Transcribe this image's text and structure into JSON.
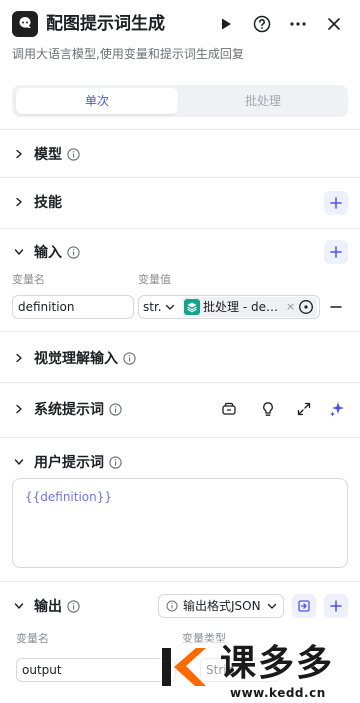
{
  "header": {
    "title": "配图提示词生成",
    "subtitle": "调用大语言模型,使用变量和提示词生成回复",
    "icons": [
      "app-logo-icon",
      "play-icon",
      "help-icon",
      "more-icon",
      "close-icon"
    ]
  },
  "tabs": [
    {
      "label": "单次",
      "active": true
    },
    {
      "label": "批处理",
      "active": false
    }
  ],
  "sections": {
    "model": {
      "label": "模型"
    },
    "skills": {
      "label": "技能"
    },
    "input": {
      "label": "输入",
      "col_name": "变量名",
      "col_value": "变量值",
      "rows": [
        {
          "name": "definition",
          "type": "str.",
          "ref_source": "批处理",
          "ref_var": "defi…",
          "ref_tag": "批处理 - defi…"
        }
      ]
    },
    "vision": {
      "label": "视觉理解输入"
    },
    "system_prompt": {
      "label": "系统提示词"
    },
    "user_prompt": {
      "label": "用户提示词",
      "content": "{{definition}}"
    },
    "output": {
      "label": "输出",
      "format": "输出格式JSON",
      "col_name": "变量名",
      "col_type": "变量类型",
      "rows": [
        {
          "name": "output",
          "type": "Strin"
        }
      ]
    }
  },
  "colors": {
    "accent": "#4d53e8",
    "tag_icon": "#16a38a",
    "tag_bg": "#eef0f4",
    "watermark_orange": "#ff6a00"
  },
  "watermark": {
    "brand": "课多多",
    "url": "www.kedd.cn"
  }
}
